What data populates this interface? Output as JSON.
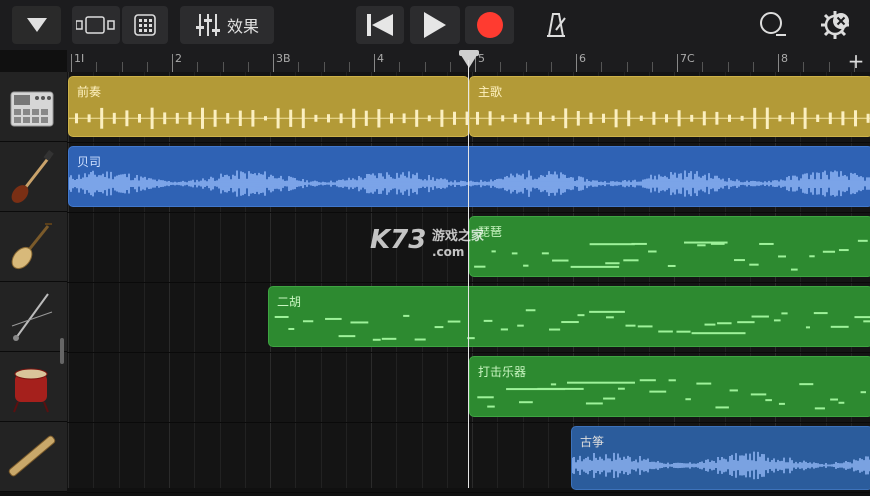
{
  "toolbar": {
    "fx_label": "效果",
    "record_color": "#ff3b30"
  },
  "ruler": {
    "labels": [
      "1I",
      "2",
      "3B",
      "4",
      "5",
      "6",
      "7C",
      "8"
    ]
  },
  "tracks": [
    {
      "instrument": "drum-machine-icon",
      "regions": [
        {
          "name": "前奏"
        },
        {
          "name": "主歌"
        }
      ]
    },
    {
      "instrument": "bass-guitar-icon",
      "regions": [
        {
          "name": "贝司"
        }
      ]
    },
    {
      "instrument": "pipa-icon",
      "regions": [
        {
          "name": "琵琶"
        }
      ]
    },
    {
      "instrument": "erhu-icon",
      "regions": [
        {
          "name": "二胡"
        }
      ]
    },
    {
      "instrument": "chinese-drum-icon",
      "regions": [
        {
          "name": "打击乐器"
        }
      ]
    },
    {
      "instrument": "guzheng-icon",
      "regions": [
        {
          "name": "古筝"
        }
      ]
    }
  ],
  "watermark": {
    "main": "K73",
    "sub": "游戏之家",
    "domain": ".com"
  },
  "colors": {
    "gold": "#b39a37",
    "blue": "#2f62b4",
    "green": "#2d8a30"
  }
}
